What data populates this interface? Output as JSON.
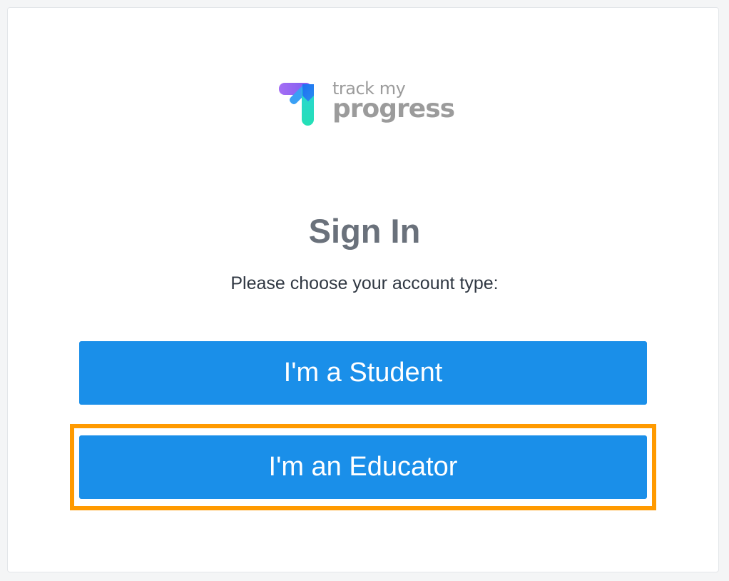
{
  "logo": {
    "line1": "track my",
    "line2": "progress",
    "icon": "track-my-progress-logo-icon"
  },
  "signin": {
    "title": "Sign In",
    "subtitle": "Please choose your account type:"
  },
  "buttons": {
    "student": "I'm a Student",
    "educator": "I'm an Educator"
  },
  "colors": {
    "button_bg": "#1a8fe9",
    "highlight": "#ff9a00",
    "title_text": "#6a717b",
    "logo_text": "#9b9b9b"
  }
}
